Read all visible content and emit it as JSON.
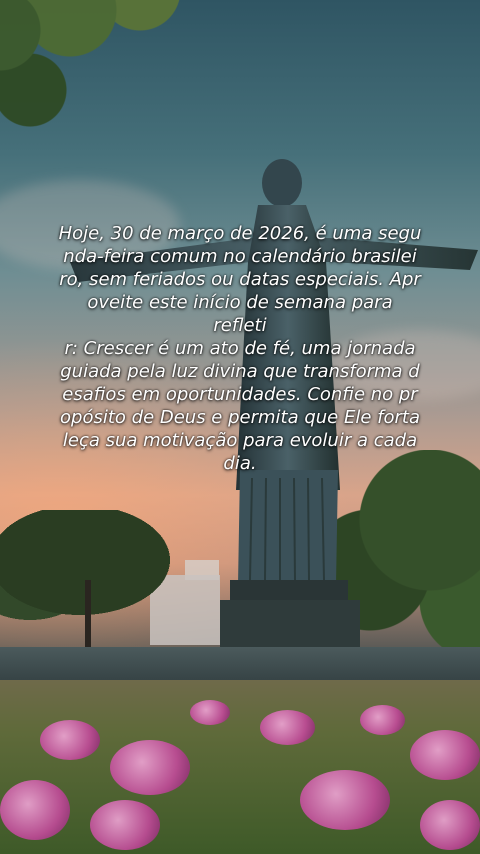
{
  "post": {
    "caption": "Hoje, 30 de março de 2026, é uma segu\nnda-feira comum no calendário brasilei\nro, sem feriados ou datas especiais. Apr\noveite este início de semana para refleti\nr: Crescer é um ato de fé, uma jornada\nguiada pela luz divina que transforma d\nesafios em oportunidades. Confie no pr\nopósito de Deus e permita que Ele forta\nleça sua motivação para evoluir a cada\ndia."
  },
  "scene": {
    "subject": "christ-the-redeemer-statue",
    "colors": {
      "sky_top": "#2f5563",
      "sky_glow": "#d9a48a",
      "statue": "#34474f",
      "flowers": "#c24a9a"
    }
  }
}
